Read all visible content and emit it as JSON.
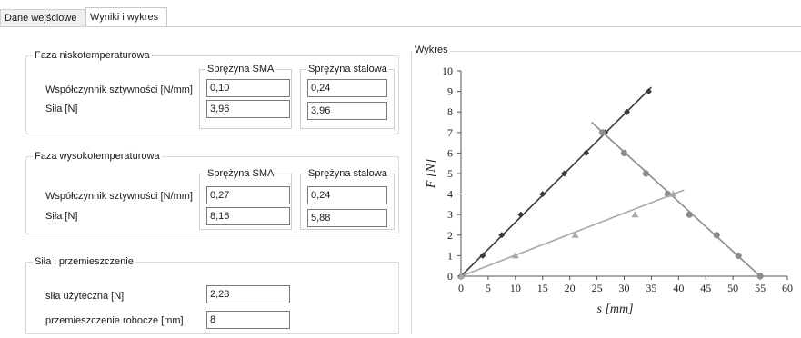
{
  "tabs": [
    {
      "label": "Dane wejściowe",
      "active": false
    },
    {
      "label": "Wyniki i wykres",
      "active": true
    }
  ],
  "low_temp": {
    "title": "Faza niskotemperaturowa",
    "col_sma": "Sprężyna SMA",
    "col_steel": "Sprężyna stalowa",
    "row_stiffness": "Współczynnik  sztywności [N/mm]",
    "row_force": "Siła [N]",
    "stiffness_sma": "0,10",
    "stiffness_steel": "0,24",
    "force_sma": "3,96",
    "force_steel": "3,96"
  },
  "high_temp": {
    "title": "Faza wysokotemperaturowa",
    "col_sma": "Sprężyna SMA",
    "col_steel": "Sprężyna stalowa",
    "row_stiffness": "Współczynnik  sztywności [N/mm]",
    "row_force": "Siła [N]",
    "stiffness_sma": "0,27",
    "stiffness_steel": "0,24",
    "force_sma": "8,16",
    "force_steel": "5,88"
  },
  "force_disp": {
    "title": "Siła i przemieszczenie",
    "useful_force_label": "siła użyteczna [N]",
    "useful_force_value": "2,28",
    "work_disp_label": "przemieszczenie robocze [mm]",
    "work_disp_value": "8"
  },
  "chart_panel": {
    "title": "Wykres"
  },
  "chart_data": {
    "type": "scatter",
    "xlabel": "s [mm]",
    "ylabel": "F [N]",
    "xlim": [
      0,
      60
    ],
    "ylim": [
      0,
      10
    ],
    "xticks": [
      "0",
      "5",
      "10",
      "15",
      "20",
      "25",
      "30",
      "35",
      "40",
      "45",
      "50",
      "55",
      "60"
    ],
    "yticks": [
      "0",
      "1",
      "2",
      "3",
      "4",
      "5",
      "6",
      "7",
      "8",
      "9",
      "10"
    ],
    "grid": false,
    "series": [
      {
        "marker": "diamond",
        "color": "#3a3a3a",
        "points": [
          [
            0,
            0
          ],
          [
            4,
            1
          ],
          [
            7.5,
            2
          ],
          [
            11,
            3
          ],
          [
            15,
            4
          ],
          [
            19,
            5
          ],
          [
            23,
            6
          ],
          [
            26.5,
            7
          ],
          [
            30.5,
            8
          ],
          [
            34.5,
            9
          ]
        ],
        "line": [
          [
            0,
            0
          ],
          [
            35,
            9.2
          ]
        ]
      },
      {
        "marker": "circle",
        "color": "#8c8c8c",
        "points": [
          [
            26,
            7
          ],
          [
            30,
            6
          ],
          [
            34,
            5
          ],
          [
            38,
            4
          ],
          [
            42,
            3
          ],
          [
            47,
            2
          ],
          [
            51,
            1
          ],
          [
            55,
            0
          ]
        ],
        "line": [
          [
            24,
            7.5
          ],
          [
            55,
            0
          ]
        ]
      },
      {
        "marker": "triangle",
        "color": "#a8a8a8",
        "points": [
          [
            0,
            0
          ],
          [
            10,
            1
          ],
          [
            21,
            2
          ],
          [
            32,
            3
          ],
          [
            39,
            4
          ]
        ],
        "line": [
          [
            0,
            0
          ],
          [
            41,
            4.2
          ]
        ]
      }
    ]
  }
}
